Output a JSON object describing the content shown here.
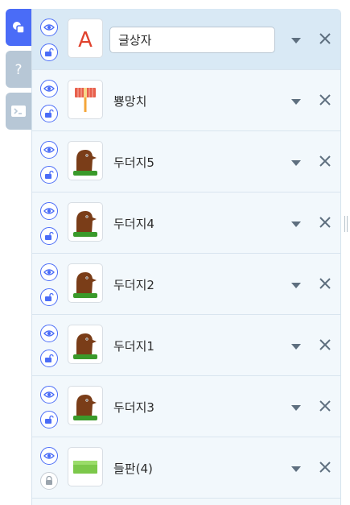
{
  "side_tabs": [
    {
      "icon": "objects-icon",
      "active": true
    },
    {
      "icon": "help-icon",
      "active": false
    },
    {
      "icon": "console-icon",
      "active": false
    }
  ],
  "objects": [
    {
      "name": "글상자",
      "thumbnail": "text-box-icon",
      "editing": true,
      "locked": false
    },
    {
      "name": "뿅망치",
      "thumbnail": "toy-hammer-icon",
      "editing": false,
      "locked": false
    },
    {
      "name": "두더지5",
      "thumbnail": "mole-icon",
      "editing": false,
      "locked": false
    },
    {
      "name": "두더지4",
      "thumbnail": "mole-icon",
      "editing": false,
      "locked": false
    },
    {
      "name": "두더지2",
      "thumbnail": "mole-icon",
      "editing": false,
      "locked": false
    },
    {
      "name": "두더지1",
      "thumbnail": "mole-icon",
      "editing": false,
      "locked": false
    },
    {
      "name": "두더지3",
      "thumbnail": "mole-icon",
      "editing": false,
      "locked": false
    },
    {
      "name": "들판(4)",
      "thumbnail": "field-icon",
      "editing": false,
      "locked": true
    }
  ],
  "colors": {
    "accent": "#4a6cf7",
    "panel_bg": "#f2f8fc",
    "selected_row": "#d9e9f5"
  }
}
